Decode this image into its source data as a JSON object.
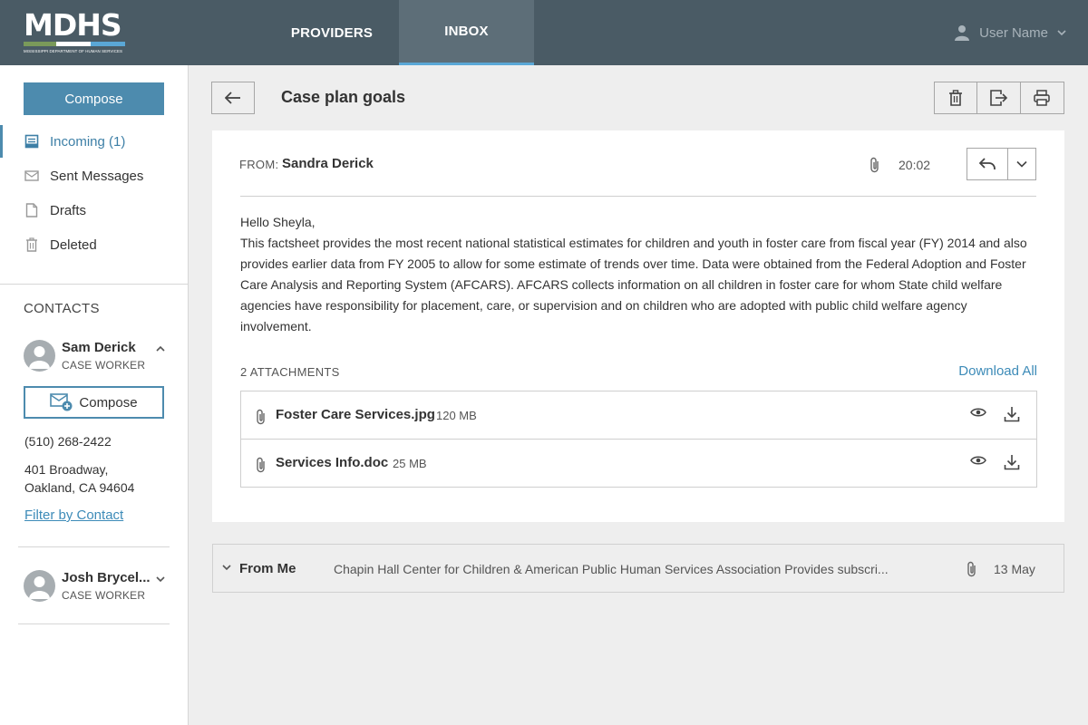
{
  "header": {
    "logo": {
      "text": "MDHS",
      "subtitle": "MISSISSIPPI DEPARTMENT OF HUMAN SERVICES",
      "bar_colors": [
        "#7a9a5a",
        "#ffffff",
        "#5aa7d6"
      ]
    },
    "nav": [
      {
        "label": "PROVIDERS",
        "active": false
      },
      {
        "label": "INBOX",
        "active": true
      }
    ],
    "user": {
      "name": "User Name"
    }
  },
  "sidebar": {
    "compose_label": "Compose",
    "folders": [
      {
        "label": "Incoming (1)",
        "icon": "inbox-icon",
        "active": true
      },
      {
        "label": "Sent Messages",
        "icon": "envelope-icon",
        "active": false
      },
      {
        "label": "Drafts",
        "icon": "document-icon",
        "active": false
      },
      {
        "label": "Deleted",
        "icon": "trash-icon",
        "active": false
      }
    ],
    "contacts_title": "CONTACTS",
    "contacts": [
      {
        "name": "Sam Derick",
        "role": "CASE WORKER",
        "expanded": true,
        "compose_label": "Compose",
        "phone": "(510) 268-2422",
        "address_line1": "401 Broadway,",
        "address_line2": "Oakland, CA 94604",
        "filter_label": "Filter by Contact"
      },
      {
        "name": "Josh Brycel...",
        "role": "CASE WORKER",
        "expanded": false
      }
    ]
  },
  "message": {
    "subject": "Case plan goals",
    "from_label": "FROM:",
    "from_name": "Sandra Derick",
    "time": "20:02",
    "greeting": "Hello Sheyla,",
    "body": "This factsheet provides the most recent national statistical estimates for children and youth in foster care from fiscal year (FY) 2014 and also provides earlier data from FY 2005 to allow for some estimate of trends over time. Data were obtained from the Federal Adoption and Foster Care Analysis and Reporting System (AFCARS). AFCARS collects information on all children in foster care for whom State child welfare agencies have responsibility for placement, care, or supervision and on children who are adopted with public child welfare agency involvement.",
    "attachments_title": "2 ATTACHMENTS",
    "download_all_label": "Download All",
    "attachments": [
      {
        "name": "Foster Care Services.jpg",
        "size": "120 MB"
      },
      {
        "name": "Services Info.doc",
        "size": "25 MB"
      }
    ]
  },
  "thread": {
    "from": "From Me",
    "preview": "Chapin Hall Center for Children & American Public Human Services Association Provides subscri...",
    "date": "13 May"
  },
  "colors": {
    "header_bg": "#4a5b65",
    "accent": "#4d8bae",
    "link": "#3d8bb8",
    "active_tab_underline": "#5aa7d6"
  }
}
